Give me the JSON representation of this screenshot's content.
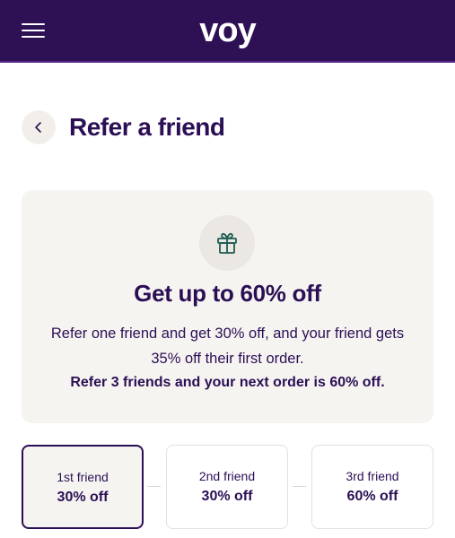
{
  "header": {
    "logo": "voy",
    "menu_icon": "hamburger-menu-icon"
  },
  "page": {
    "back_icon": "chevron-left-icon",
    "title": "Refer a friend"
  },
  "promo": {
    "icon": "gift-icon",
    "heading": "Get up to 60% off",
    "description": "Refer one friend and get 30% off, and your friend gets 35% off their first order.",
    "highlight": "Refer 3 friends and your next order is 60% off."
  },
  "steps": [
    {
      "label": "1st friend",
      "value": "30% off",
      "selected": true
    },
    {
      "label": "2nd friend",
      "value": "30% off",
      "selected": false
    },
    {
      "label": "3rd friend",
      "value": "60% off",
      "selected": false
    }
  ],
  "colors": {
    "brand_purple": "#2e1055",
    "text": "#2b0f55",
    "card_bg": "#f6f4f1",
    "gift_icon": "#1f5c55"
  }
}
